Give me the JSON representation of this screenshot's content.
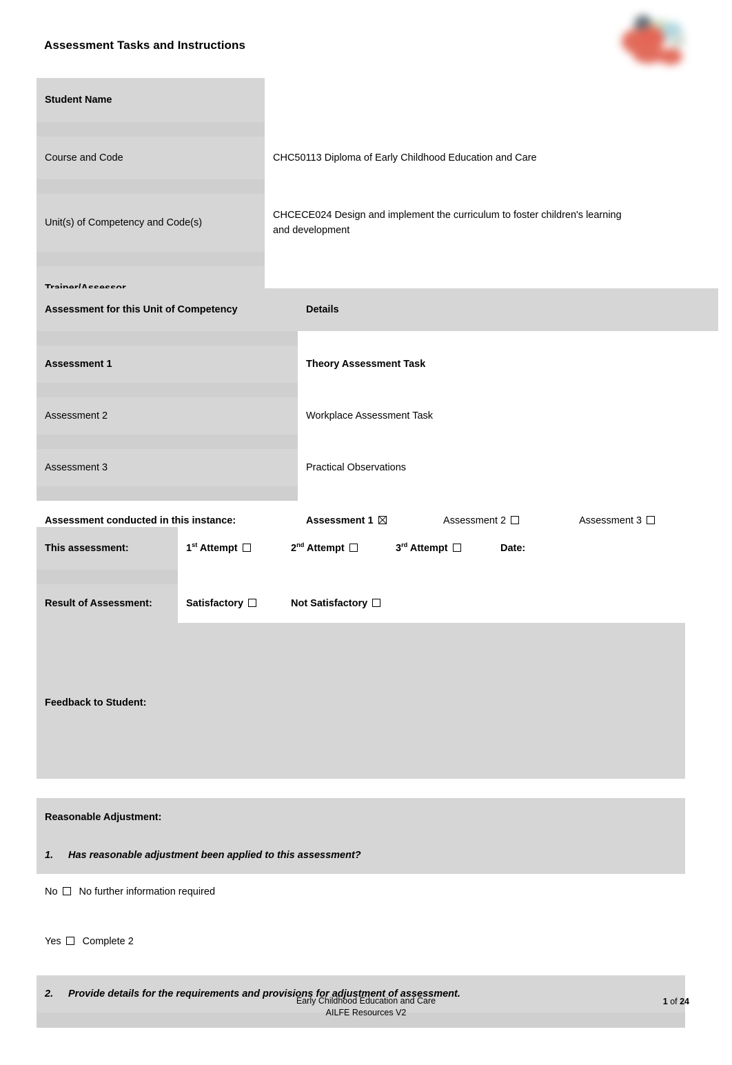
{
  "header": {
    "title": "Assessment Tasks and Instructions",
    "logo_name": "ailfe-logo"
  },
  "student_table": {
    "rows": [
      {
        "label": "Student Name",
        "value": "",
        "label_bold": true,
        "value_bold": false
      },
      {
        "label": "Course and Code",
        "value": "CHC50113 Diploma of Early Childhood Education and Care",
        "label_bold": false,
        "value_bold": false
      },
      {
        "label": "Unit(s) of Competency and Code(s)",
        "value": "CHCECE024 Design and implement the curriculum to foster children's learning and development",
        "label_bold": false,
        "value_bold": false
      },
      {
        "label": "Trainer/Assessor",
        "value": "",
        "label_bold": true,
        "value_bold": false
      }
    ]
  },
  "assessment_table": {
    "header_left": "Assessment for this Unit of Competency",
    "header_right": "Details",
    "rows": [
      {
        "label": "Assessment 1",
        "value": "Theory Assessment Task",
        "bold": true
      },
      {
        "label": "Assessment 2",
        "value": "Workplace Assessment Task",
        "bold": false
      },
      {
        "label": "Assessment 3",
        "value": "Practical Observations",
        "bold": false
      }
    ],
    "conducted_label": "Assessment conducted in this instance:",
    "conducted_options": [
      {
        "label": "Assessment 1",
        "checked": true,
        "bold": true
      },
      {
        "label": "Assessment 2",
        "checked": false,
        "bold": false
      },
      {
        "label": "Assessment 3",
        "checked": false,
        "bold": false
      }
    ]
  },
  "result_table": {
    "attempt_label": "This assessment:",
    "attempts": [
      {
        "number": "1",
        "ordinal": "st",
        "label": " Attempt",
        "checked": false
      },
      {
        "number": "2",
        "ordinal": "nd",
        "label": " Attempt",
        "checked": false
      },
      {
        "number": "3",
        "ordinal": "rd",
        "label": " Attempt",
        "checked": false
      }
    ],
    "date_label": "Date:",
    "date_value": "",
    "result_label": "Result of Assessment:",
    "results": [
      {
        "label": "Satisfactory",
        "checked": false
      },
      {
        "label": "Not Satisfactory",
        "checked": false
      }
    ],
    "feedback_label": "Feedback to Student:",
    "feedback_value": ""
  },
  "adjustment_table": {
    "title": "Reasonable Adjustment:",
    "q1_number": "1.",
    "q1_text": "Has reasonable adjustment been applied to this assessment?",
    "no_label": "No",
    "no_note": "No further information required",
    "yes_label": "Yes",
    "yes_note": "Complete 2",
    "q2_number": "2.",
    "q2_text": "Provide details for the requirements and provisions for adjustment of assessment.",
    "details_value": ""
  },
  "footer": {
    "line1": "Early Childhood Education and Care",
    "line2": "AILFE Resources V2",
    "page_current": "1",
    "page_of": " of ",
    "page_total": "24"
  },
  "colors": {
    "table_gray": "#d6d6d6",
    "separator_gray": "#cfcfcf",
    "text": "#000000",
    "logo_red": "#e0604f",
    "logo_blue": "#a8d4dd",
    "logo_dark": "#5a6670"
  }
}
